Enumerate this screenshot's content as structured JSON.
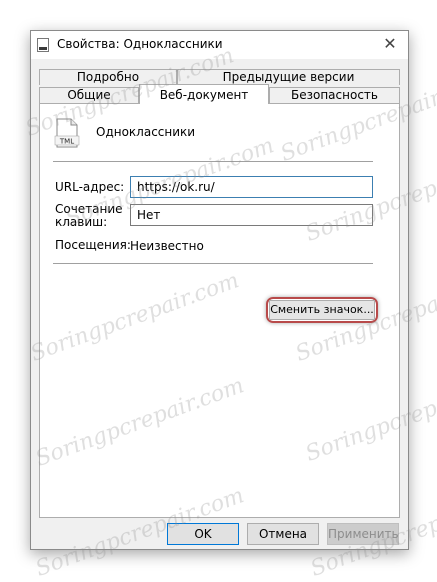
{
  "window": {
    "title": "Свойства: Одноклассники",
    "close_glyph": "✕"
  },
  "tabs_back": [
    "Подробно",
    "Предыдущие версии"
  ],
  "tabs_front": [
    "Общие",
    "Веб-документ",
    "Безопасность"
  ],
  "active_tab": "Веб-документ",
  "document": {
    "icon_label": "TML",
    "name": "Одноклассники"
  },
  "fields": {
    "url_label": "URL-адрес:",
    "url_value": "https://ok.ru/",
    "shortcut_label_1": "Сочетание",
    "shortcut_label_2": "клавиш:",
    "shortcut_value": "Нет",
    "visits_label": "Посещения:",
    "visits_value": "Неизвестно"
  },
  "buttons": {
    "change_icon": "Сменить значок...",
    "ok": "OK",
    "cancel": "Отмена",
    "apply": "Применить"
  },
  "watermark": "Soringpcrepair.com",
  "colors": {
    "highlight": "#b84a4a",
    "focus_border": "#3c7fb1"
  }
}
